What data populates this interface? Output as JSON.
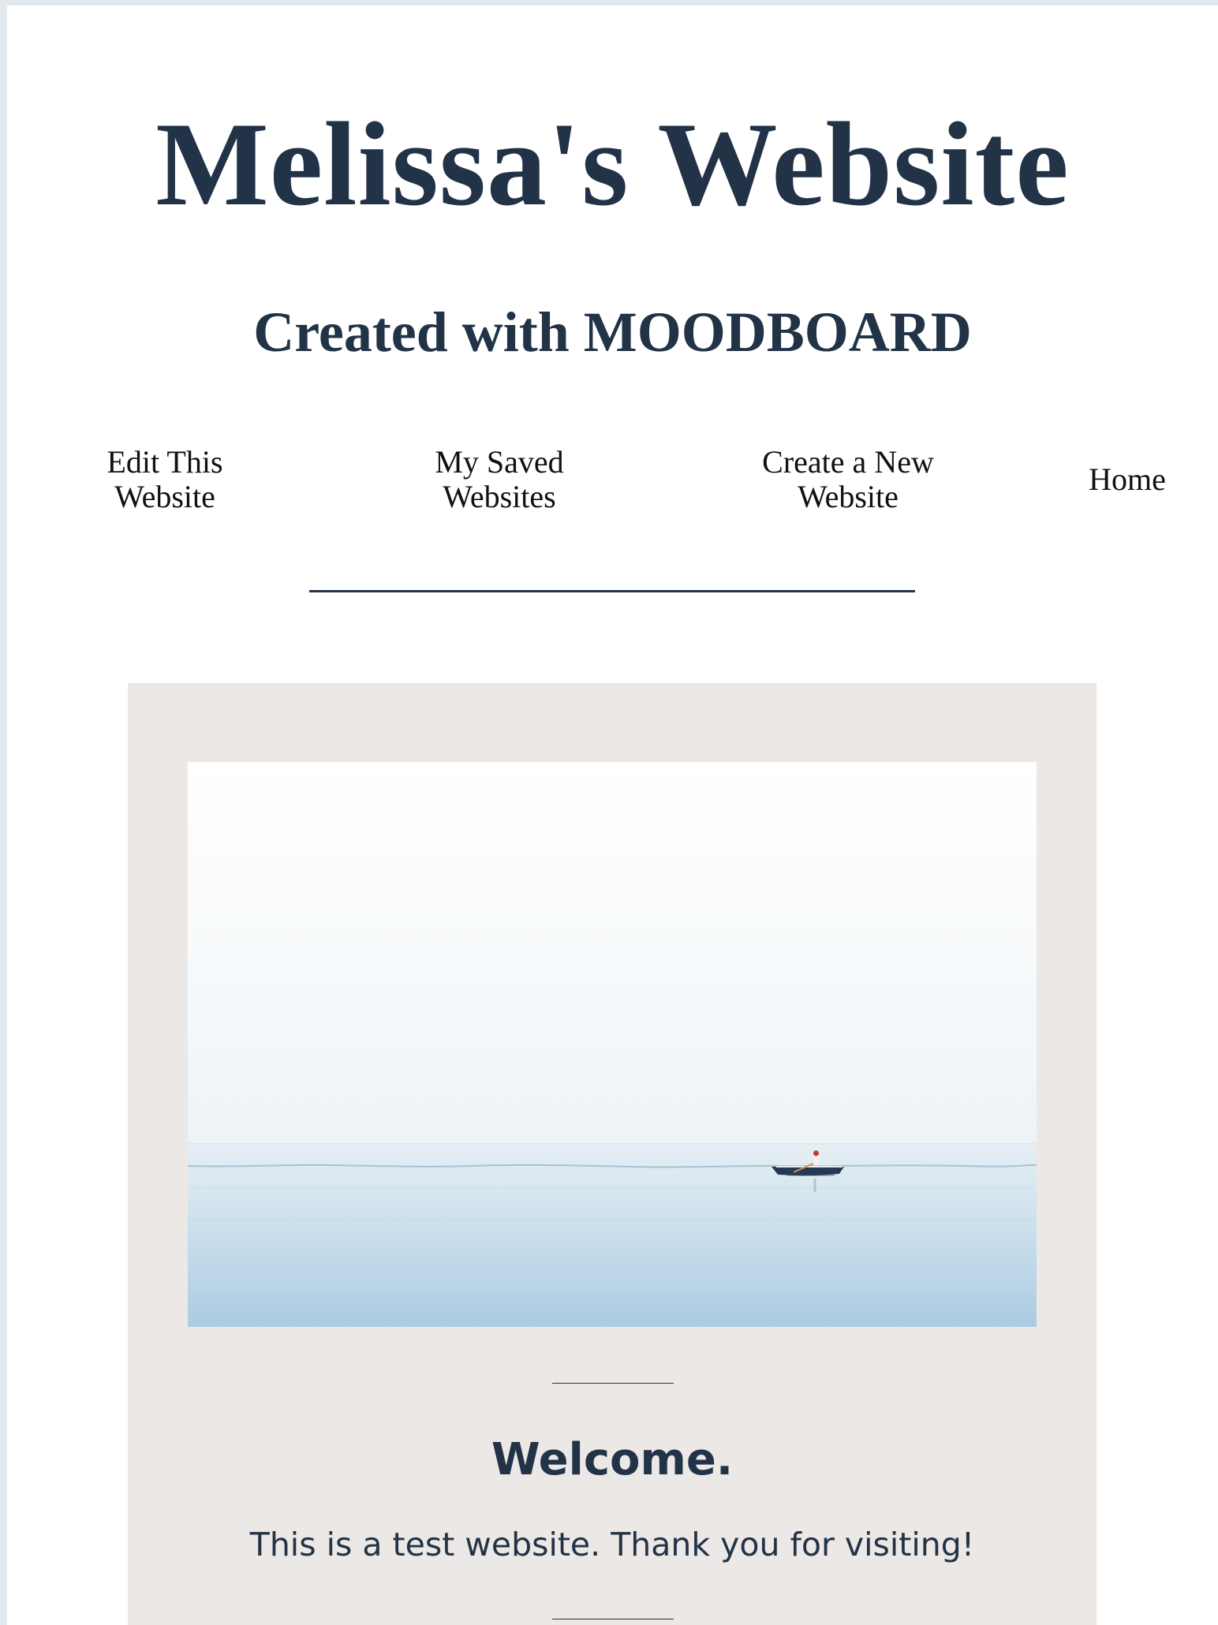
{
  "header": {
    "title": "Melissa's Website",
    "subtitle": "Created with MOODBOARD"
  },
  "nav": {
    "items": [
      {
        "line1": "Edit This",
        "line2": "Website"
      },
      {
        "line1": "My Saved",
        "line2": "Websites"
      },
      {
        "line1": "Create a New",
        "line2": "Website"
      },
      {
        "line1": "Home",
        "line2": ""
      }
    ]
  },
  "hero": {
    "image": "rowboat-on-calm-sea-photo"
  },
  "content": {
    "heading": "Welcome.",
    "body": "This is a test website. Thank you for visiting!"
  },
  "colors": {
    "text_dark": "#223347",
    "card_background": "#ebe8e6",
    "page_background": "#ffffff",
    "outer_background": "#e3e8ef"
  }
}
